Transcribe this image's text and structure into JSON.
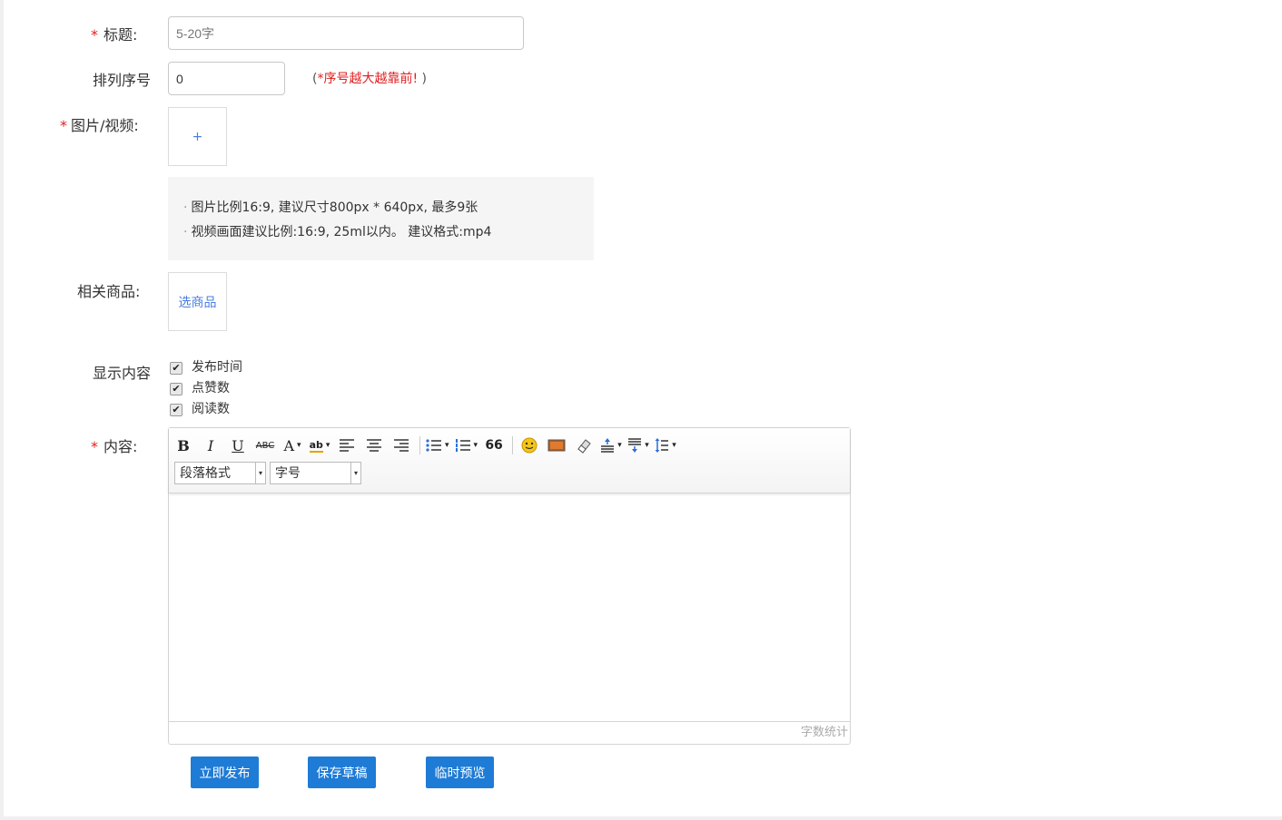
{
  "form": {
    "title": {
      "label": "标题:",
      "required_mark": "*",
      "placeholder": "5-20字",
      "value": ""
    },
    "sort": {
      "label": "排列序号",
      "value": "0",
      "hint_open": "(",
      "hint": "*序号越大越靠前!",
      "hint_close": " )"
    },
    "media": {
      "label": "图片/视频:",
      "required_mark": "*",
      "add_symbol": "+"
    },
    "media_tips": [
      {
        "bullet": "·",
        "text": "图片比例16:9, 建议尺寸800px * 640px, 最多9张"
      },
      {
        "bullet": "·",
        "text": "视频画面建议比例:16:9, 25ml以内。 建议格式:mp4"
      }
    ],
    "products": {
      "label": "相关商品:",
      "button": "选商品"
    },
    "display": {
      "label": "显示内容",
      "options": [
        {
          "label": "发布时间",
          "checked": true
        },
        {
          "label": "点赞数",
          "checked": true
        },
        {
          "label": "阅读数",
          "checked": true
        }
      ]
    },
    "content": {
      "label": "内容:",
      "required_mark": "*"
    }
  },
  "editor": {
    "toolbar": {
      "bold": "B",
      "italic": "I",
      "underline": "U",
      "strike": "ABC",
      "font_color": "A",
      "highlight": "ab",
      "caret": "▾",
      "quote": "66"
    },
    "paragraph_select": "段落格式",
    "fontsize_select": "字号",
    "word_count": "字数统计"
  },
  "actions": {
    "publish": "立即发布",
    "save_draft": "保存草稿",
    "preview": "临时预览"
  },
  "colors": {
    "primary": "#1e7bd6",
    "required": "#e02020",
    "link": "#4a7ee0"
  }
}
